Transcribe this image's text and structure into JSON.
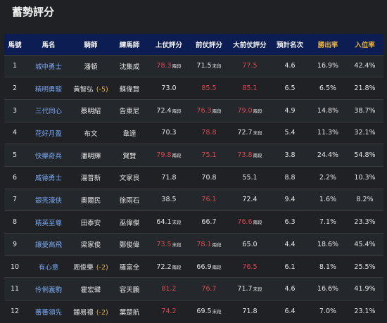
{
  "page_title": "蓄勢評分",
  "columns": [
    "馬號",
    "馬名",
    "騎師",
    "練馬師",
    "上仗評分",
    "前仗評分",
    "大前仗評分",
    "預計名次",
    "勝出率",
    "入位率"
  ],
  "rows": [
    {
      "no": "1",
      "horse": "城中勇士",
      "jockey": "潘頓",
      "jockey_note": "",
      "trainer": "沈集成",
      "r1": "78.3",
      "r1_tag": "兩段",
      "r1_red": true,
      "r2": "71.5",
      "r2_tag": "末段",
      "r2_red": false,
      "r3": "77.5",
      "r3_tag": "",
      "r3_red": true,
      "rank": "4.6",
      "win": "16.9%",
      "place": "42.4%"
    },
    {
      "no": "2",
      "horse": "精明勇駿",
      "jockey": "黃智弘",
      "jockey_note": "(-5)",
      "trainer": "蘇偉賢",
      "r1": "73.0",
      "r1_tag": "",
      "r1_red": false,
      "r2": "85.5",
      "r2_tag": "",
      "r2_red": true,
      "r3": "85.1",
      "r3_tag": "",
      "r3_red": true,
      "rank": "6.5",
      "win": "6.5%",
      "place": "21.8%"
    },
    {
      "no": "3",
      "horse": "三代同心",
      "jockey": "蔡明紹",
      "jockey_note": "",
      "trainer": "告東尼",
      "r1": "72.4",
      "r1_tag": "兩段",
      "r1_red": false,
      "r2": "76.3",
      "r2_tag": "兩段",
      "r2_red": true,
      "r3": "79.0",
      "r3_tag": "兩段",
      "r3_red": true,
      "rank": "4.9",
      "win": "14.8%",
      "place": "38.7%"
    },
    {
      "no": "4",
      "horse": "花好月盈",
      "jockey": "布文",
      "jockey_note": "",
      "trainer": "韋達",
      "r1": "70.3",
      "r1_tag": "",
      "r1_red": false,
      "r2": "78.8",
      "r2_tag": "",
      "r2_red": true,
      "r3": "72.7",
      "r3_tag": "末段",
      "r3_red": false,
      "rank": "5.4",
      "win": "11.3%",
      "place": "32.1%"
    },
    {
      "no": "5",
      "horse": "快樂奇兵",
      "jockey": "潘明輝",
      "jockey_note": "",
      "trainer": "賀賢",
      "r1": "79.8",
      "r1_tag": "兩段",
      "r1_red": true,
      "r2": "75.1",
      "r2_tag": "",
      "r2_red": true,
      "r3": "73.8",
      "r3_tag": "兩段",
      "r3_red": true,
      "rank": "3.8",
      "win": "24.4%",
      "place": "54.8%"
    },
    {
      "no": "6",
      "horse": "威德勇士",
      "jockey": "湯普新",
      "jockey_note": "",
      "trainer": "文家良",
      "r1": "71.8",
      "r1_tag": "",
      "r1_red": false,
      "r2": "70.8",
      "r2_tag": "",
      "r2_red": false,
      "r3": "55.1",
      "r3_tag": "",
      "r3_red": false,
      "rank": "8.8",
      "win": "2.2%",
      "place": "10.3%"
    },
    {
      "no": "7",
      "horse": "銀亮濠俠",
      "jockey": "奧爾民",
      "jockey_note": "",
      "trainer": "徐雨石",
      "r1": "38.5",
      "r1_tag": "",
      "r1_red": false,
      "r2": "76.1",
      "r2_tag": "",
      "r2_red": true,
      "r3": "72.4",
      "r3_tag": "",
      "r3_red": false,
      "rank": "9.4",
      "win": "1.6%",
      "place": "8.2%"
    },
    {
      "no": "8",
      "horse": "精英至尊",
      "jockey": "田泰安",
      "jockey_note": "",
      "trainer": "巫偉傑",
      "r1": "64.1",
      "r1_tag": "末段",
      "r1_red": false,
      "r2": "66.7",
      "r2_tag": "",
      "r2_red": false,
      "r3": "76.6",
      "r3_tag": "兩段",
      "r3_red": true,
      "rank": "6.3",
      "win": "7.1%",
      "place": "23.3%"
    },
    {
      "no": "9",
      "horse": "讓愛高飛",
      "jockey": "梁家俊",
      "jockey_note": "",
      "trainer": "鄭俊偉",
      "r1": "73.5",
      "r1_tag": "末段",
      "r1_red": true,
      "r2": "78.1",
      "r2_tag": "兩段",
      "r2_red": true,
      "r3": "65.0",
      "r3_tag": "",
      "r3_red": false,
      "rank": "4.4",
      "win": "18.6%",
      "place": "45.4%"
    },
    {
      "no": "10",
      "horse": "有心意",
      "jockey": "周俊樂",
      "jockey_note": "(-2)",
      "trainer": "羅富全",
      "r1": "72.2",
      "r1_tag": "兩段",
      "r1_red": false,
      "r2": "66.9",
      "r2_tag": "兩段",
      "r2_red": false,
      "r3": "76.5",
      "r3_tag": "",
      "r3_red": true,
      "rank": "6.1",
      "win": "8.1%",
      "place": "25.5%"
    },
    {
      "no": "11",
      "horse": "伶俐義駒",
      "jockey": "霍宏聲",
      "jockey_note": "",
      "trainer": "容天鵬",
      "r1": "81.2",
      "r1_tag": "",
      "r1_red": true,
      "r2": "76.7",
      "r2_tag": "",
      "r2_red": true,
      "r3": "71.7",
      "r3_tag": "末段",
      "r3_red": false,
      "rank": "4.6",
      "win": "16.6%",
      "place": "41.9%"
    },
    {
      "no": "12",
      "horse": "蕃蕃領先",
      "jockey": "鍾易禮",
      "jockey_note": "(-2)",
      "trainer": "葉楚航",
      "r1": "74.2",
      "r1_tag": "",
      "r1_red": true,
      "r2": "69.5",
      "r2_tag": "末段",
      "r2_red": false,
      "r3": "71.8",
      "r3_tag": "",
      "r3_red": false,
      "rank": "6.4",
      "win": "7.0%",
      "place": "23.1%"
    }
  ],
  "colors": {
    "background": "#1f2125",
    "header": "#0b1d52",
    "gold": "#e8b33d",
    "red": "#d9484d",
    "link": "#79a7f0"
  }
}
